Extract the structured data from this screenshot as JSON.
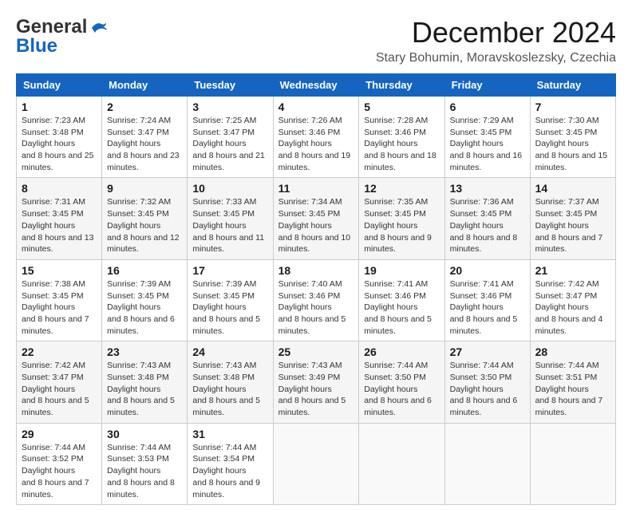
{
  "logo": {
    "general": "General",
    "blue": "Blue"
  },
  "title": "December 2024",
  "location": "Stary Bohumin, Moravskoslezsky, Czechia",
  "days_of_week": [
    "Sunday",
    "Monday",
    "Tuesday",
    "Wednesday",
    "Thursday",
    "Friday",
    "Saturday"
  ],
  "weeks": [
    [
      {
        "day": "1",
        "sunrise": "7:23 AM",
        "sunset": "3:48 PM",
        "daylight": "8 hours and 25 minutes."
      },
      {
        "day": "2",
        "sunrise": "7:24 AM",
        "sunset": "3:47 PM",
        "daylight": "8 hours and 23 minutes."
      },
      {
        "day": "3",
        "sunrise": "7:25 AM",
        "sunset": "3:47 PM",
        "daylight": "8 hours and 21 minutes."
      },
      {
        "day": "4",
        "sunrise": "7:26 AM",
        "sunset": "3:46 PM",
        "daylight": "8 hours and 19 minutes."
      },
      {
        "day": "5",
        "sunrise": "7:28 AM",
        "sunset": "3:46 PM",
        "daylight": "8 hours and 18 minutes."
      },
      {
        "day": "6",
        "sunrise": "7:29 AM",
        "sunset": "3:45 PM",
        "daylight": "8 hours and 16 minutes."
      },
      {
        "day": "7",
        "sunrise": "7:30 AM",
        "sunset": "3:45 PM",
        "daylight": "8 hours and 15 minutes."
      }
    ],
    [
      {
        "day": "8",
        "sunrise": "7:31 AM",
        "sunset": "3:45 PM",
        "daylight": "8 hours and 13 minutes."
      },
      {
        "day": "9",
        "sunrise": "7:32 AM",
        "sunset": "3:45 PM",
        "daylight": "8 hours and 12 minutes."
      },
      {
        "day": "10",
        "sunrise": "7:33 AM",
        "sunset": "3:45 PM",
        "daylight": "8 hours and 11 minutes."
      },
      {
        "day": "11",
        "sunrise": "7:34 AM",
        "sunset": "3:45 PM",
        "daylight": "8 hours and 10 minutes."
      },
      {
        "day": "12",
        "sunrise": "7:35 AM",
        "sunset": "3:45 PM",
        "daylight": "8 hours and 9 minutes."
      },
      {
        "day": "13",
        "sunrise": "7:36 AM",
        "sunset": "3:45 PM",
        "daylight": "8 hours and 8 minutes."
      },
      {
        "day": "14",
        "sunrise": "7:37 AM",
        "sunset": "3:45 PM",
        "daylight": "8 hours and 7 minutes."
      }
    ],
    [
      {
        "day": "15",
        "sunrise": "7:38 AM",
        "sunset": "3:45 PM",
        "daylight": "8 hours and 7 minutes."
      },
      {
        "day": "16",
        "sunrise": "7:39 AM",
        "sunset": "3:45 PM",
        "daylight": "8 hours and 6 minutes."
      },
      {
        "day": "17",
        "sunrise": "7:39 AM",
        "sunset": "3:45 PM",
        "daylight": "8 hours and 5 minutes."
      },
      {
        "day": "18",
        "sunrise": "7:40 AM",
        "sunset": "3:46 PM",
        "daylight": "8 hours and 5 minutes."
      },
      {
        "day": "19",
        "sunrise": "7:41 AM",
        "sunset": "3:46 PM",
        "daylight": "8 hours and 5 minutes."
      },
      {
        "day": "20",
        "sunrise": "7:41 AM",
        "sunset": "3:46 PM",
        "daylight": "8 hours and 5 minutes."
      },
      {
        "day": "21",
        "sunrise": "7:42 AM",
        "sunset": "3:47 PM",
        "daylight": "8 hours and 4 minutes."
      }
    ],
    [
      {
        "day": "22",
        "sunrise": "7:42 AM",
        "sunset": "3:47 PM",
        "daylight": "8 hours and 5 minutes."
      },
      {
        "day": "23",
        "sunrise": "7:43 AM",
        "sunset": "3:48 PM",
        "daylight": "8 hours and 5 minutes."
      },
      {
        "day": "24",
        "sunrise": "7:43 AM",
        "sunset": "3:48 PM",
        "daylight": "8 hours and 5 minutes."
      },
      {
        "day": "25",
        "sunrise": "7:43 AM",
        "sunset": "3:49 PM",
        "daylight": "8 hours and 5 minutes."
      },
      {
        "day": "26",
        "sunrise": "7:44 AM",
        "sunset": "3:50 PM",
        "daylight": "8 hours and 6 minutes."
      },
      {
        "day": "27",
        "sunrise": "7:44 AM",
        "sunset": "3:50 PM",
        "daylight": "8 hours and 6 minutes."
      },
      {
        "day": "28",
        "sunrise": "7:44 AM",
        "sunset": "3:51 PM",
        "daylight": "8 hours and 7 minutes."
      }
    ],
    [
      {
        "day": "29",
        "sunrise": "7:44 AM",
        "sunset": "3:52 PM",
        "daylight": "8 hours and 7 minutes."
      },
      {
        "day": "30",
        "sunrise": "7:44 AM",
        "sunset": "3:53 PM",
        "daylight": "8 hours and 8 minutes."
      },
      {
        "day": "31",
        "sunrise": "7:44 AM",
        "sunset": "3:54 PM",
        "daylight": "8 hours and 9 minutes."
      },
      null,
      null,
      null,
      null
    ]
  ]
}
